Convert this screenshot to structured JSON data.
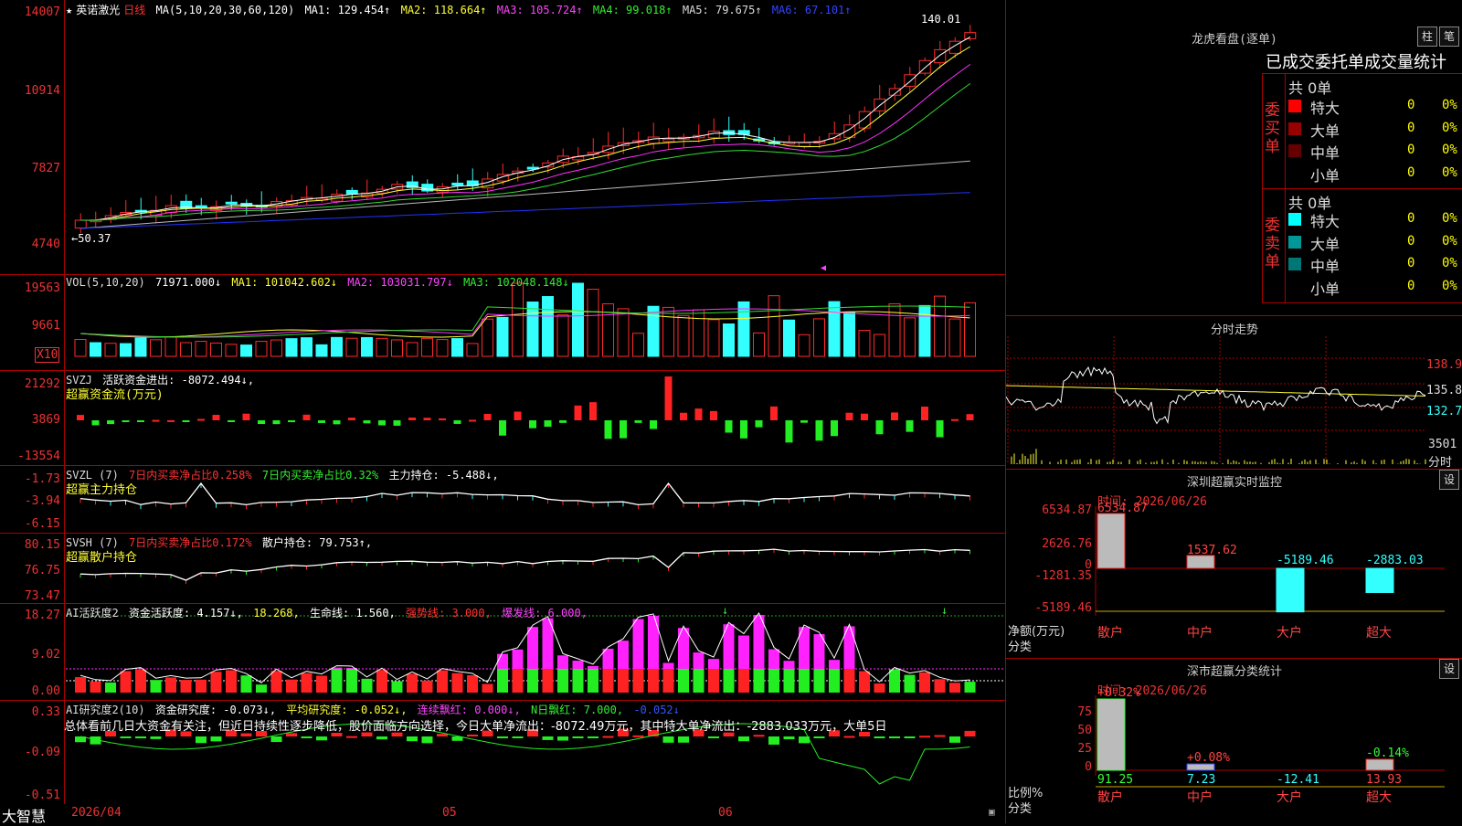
{
  "main": {
    "stock_name": "英诺激光",
    "period": "日线",
    "ma_params": "MA(5,10,20,30,60,120)",
    "ma_labels": [
      "MA1: 129.454↑",
      "MA2: 118.664↑",
      "MA3: 105.724↑",
      "MA4: 99.018↑",
      "MA5: 79.675↑",
      "MA6: 67.101↑"
    ],
    "y_labels": [
      "14007",
      "10914",
      "7827",
      "4740"
    ],
    "high_label": "140.01",
    "low_label": "←50.37",
    "colors": {
      "up": "#ff2a2a",
      "down": "#33ffff",
      "ma1": "#ffffff",
      "ma2": "#ffff33",
      "ma3": "#ff33ff",
      "ma4": "#33dd33",
      "ma5": "#bbbbbb",
      "ma6": "#2233ff"
    }
  },
  "volume": {
    "header": "VOL(5,10,20)",
    "value": "71971.000↓",
    "ma_labels": [
      "MA1: 101042.602↓",
      "MA2: 103031.797↓",
      "MA3: 102048.148↓"
    ],
    "y_labels": [
      "19563",
      "9661"
    ],
    "unit": "X10"
  },
  "svzj": {
    "name": "SVZJ",
    "label": "活跃资金进出: -8072.494↓,",
    "subtitle": "超赢资金流(万元)",
    "y_labels": [
      "21292",
      "3869",
      "-13554"
    ]
  },
  "svzl": {
    "name": "SVZL (7)",
    "label1": "7日内买卖净占比0.258%",
    "label2": "7日内买卖净占比0.32%",
    "label3": "主力持仓: -5.488↓,",
    "subtitle": "超赢主力持仓",
    "y_labels": [
      "-1.73",
      "-3.94",
      "-6.15"
    ]
  },
  "svsh": {
    "name": "SVSH (7)",
    "label1": "7日内买卖净占比0.172%",
    "label2": "散户持仓: 79.753↑,",
    "subtitle": "超赢散户持仓",
    "y_labels": [
      "80.15",
      "76.75",
      "73.47"
    ]
  },
  "ai_active": {
    "name": "AI活跃度2",
    "parts": [
      "资金活跃度: 4.157↓,",
      "18.268,",
      "生命线: 1.560,",
      "强势线: 3.000,",
      "爆发线: 6.000,"
    ],
    "y_labels": [
      "18.27",
      "9.02",
      "0.00"
    ]
  },
  "ai_research": {
    "name": "AI研究度2(10)",
    "parts": [
      "资金研究度: -0.073↓,",
      "平均研究度: -0.052↓,",
      "连续飘红: 0.000↓,",
      "N日飘红: 7.000,",
      "-0.052↓"
    ],
    "commentary": "总体看前几日大资金有关注，但近日持续性逐步降低，股价面临方向选择，今日大单净流出：-8072.49万元，其中特大单净流出：-2883.033万元，大单5日",
    "y_labels": [
      "0.33",
      "-0.09",
      "-0.51"
    ]
  },
  "footer": {
    "brand": "大智慧",
    "dates": [
      "2026/04",
      "05",
      "06"
    ]
  },
  "dragon": {
    "title": "龙虎看盘(逐单)",
    "buttons": [
      "柱",
      "笔"
    ],
    "heading": "已成交委托单成交量统计",
    "buy_side": "委买单",
    "sell_side": "委卖单",
    "buy_total": "共 0单",
    "sell_total": "共 0单",
    "buy_rows": [
      {
        "name": "特大",
        "count": "0",
        "pct": "0%",
        "color": "#ff0000"
      },
      {
        "name": "大单",
        "count": "0",
        "pct": "0%",
        "color": "#990000"
      },
      {
        "name": "中单",
        "count": "0",
        "pct": "0%",
        "color": "#660000"
      },
      {
        "name": "小单",
        "count": "0",
        "pct": "0%",
        "color": "#000000"
      }
    ],
    "sell_rows": [
      {
        "name": "特大",
        "count": "0",
        "pct": "0%",
        "color": "#00ffff"
      },
      {
        "name": "大单",
        "count": "0",
        "pct": "0%",
        "color": "#009999"
      },
      {
        "name": "中单",
        "count": "0",
        "pct": "0%",
        "color": "#007777"
      },
      {
        "name": "小单",
        "count": "0",
        "pct": "0%",
        "color": "#000000"
      }
    ]
  },
  "intraday": {
    "title": "分时走势",
    "prices": [
      "138.9",
      "135.8",
      "132.7"
    ],
    "vol_label": "3501",
    "vol_unit": "分时"
  },
  "sz_monitor": {
    "title": "深圳超赢实时监控",
    "settings": "设",
    "time": "时间: 2026/06/26",
    "y_labels": [
      "6534.87",
      "2626.76",
      "0",
      "-1281.35",
      "-5189.46"
    ],
    "axis_title": "净额(万元)",
    "axis_sub": "分类",
    "categories": [
      "散户",
      "中户",
      "大户",
      "超大"
    ],
    "values": [
      6534.87,
      1537.62,
      -5189.46,
      -2883.03
    ],
    "value_labels": [
      "6534.87",
      "1537.62",
      "-5189.46",
      "-2883.03"
    ]
  },
  "sz_stats": {
    "title": "深市超赢分类统计",
    "settings": "设",
    "time": "时间: 2026/06/26",
    "y_labels": [
      "75",
      "50",
      "25",
      "0"
    ],
    "axis_title": "比例%",
    "axis_sub": "分类",
    "categories": [
      "散户",
      "中户",
      "大户",
      "超大"
    ],
    "top_labels": [
      "+0.32%",
      "+0.08%",
      "",
      "-0.14%"
    ],
    "bottom_values": [
      "91.25",
      "7.23",
      "-12.41",
      "13.93"
    ]
  }
}
